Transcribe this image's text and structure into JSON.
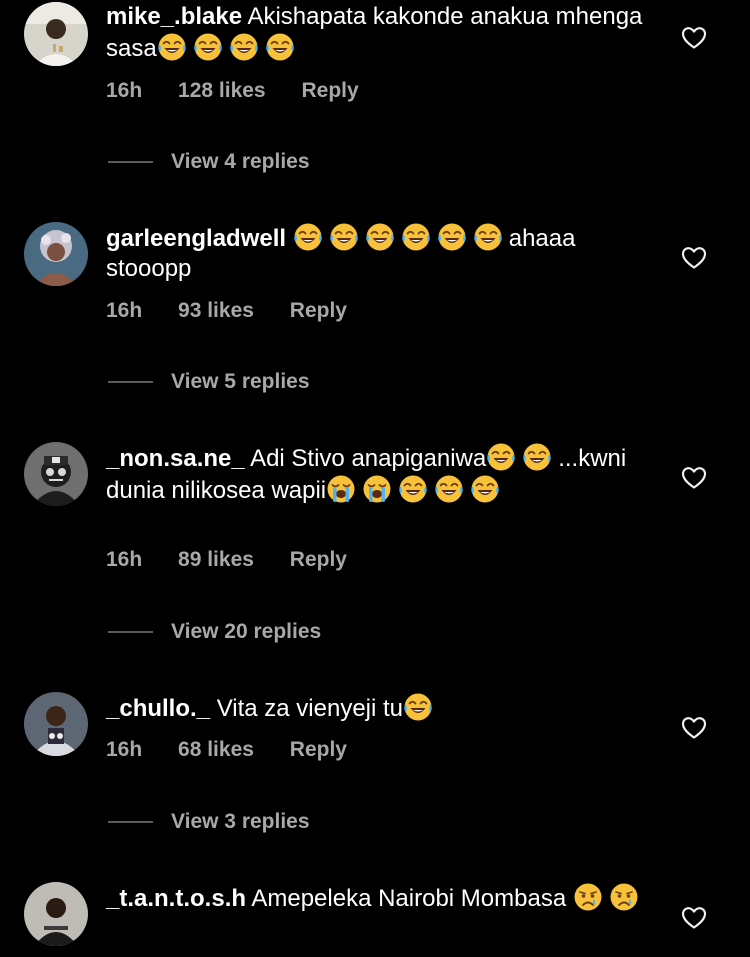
{
  "comments": [
    {
      "username": "mike_.blake",
      "text_parts": [
        "Akishapata kakonde anakua mhenga sasa"
      ],
      "time": "16h",
      "likes": "128 likes",
      "reply": "Reply",
      "view_replies": "View 4 replies"
    },
    {
      "username": "garleengladwell",
      "text_parts": [
        "ahaaa stooopp"
      ],
      "time": "16h",
      "likes": "93 likes",
      "reply": "Reply",
      "view_replies": "View 5 replies"
    },
    {
      "username": "_non.sa.ne_",
      "text_parts": [
        "Adi Stivo anapiganiwa",
        "...kwni dunia nilikosea wapii"
      ],
      "time": "16h",
      "likes": "89 likes",
      "reply": "Reply",
      "view_replies": "View 20 replies"
    },
    {
      "username": "_chullo._",
      "text_parts": [
        "Vita za vienyeji tu"
      ],
      "time": "16h",
      "likes": "68 likes",
      "reply": "Reply",
      "view_replies": "View 3 replies"
    },
    {
      "username": "_t.a.n.t.o.s.h",
      "text_parts": [
        "Amepeleka Nairobi Mombasa"
      ]
    }
  ],
  "icons": {
    "like": "heart-outline-icon",
    "laughing": "face-with-tears-of-joy-emoji",
    "crying": "loudly-crying-face-emoji",
    "sad": "crying-face-emoji"
  },
  "colors": {
    "background": "#000000",
    "primary_text": "#ffffff",
    "secondary_text": "#a8a8a8",
    "reply_line": "#5b5b5b"
  }
}
